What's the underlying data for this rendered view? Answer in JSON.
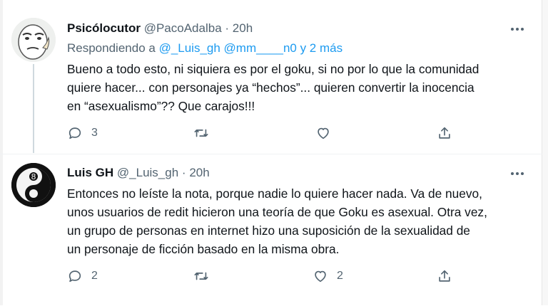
{
  "tweets": [
    {
      "name": "Psicólocutor",
      "handle": "@PacoAdalba",
      "dot": "·",
      "time": "20h",
      "reply_prefix": "Respondiendo a",
      "reply_mentions": "@_Luis_gh @mm____n0 y 2 más",
      "lines": [
        "Bueno a todo esto, ni siquiera es por el goku, si no por lo que la comunidad",
        "quiere hacer... con personajes ya “hechos”... quieren convertir la inocencia",
        "en “asexualismo”?? Que carajos!!!"
      ],
      "reply_count": "3",
      "retweet_count": "",
      "like_count": ""
    },
    {
      "name": "Luis GH",
      "handle": "@_Luis_gh",
      "dot": "·",
      "time": "20h",
      "lines": [
        "Entonces no leíste la nota, porque nadie lo quiere hacer nada. Va de nuevo,",
        "unos usuarios de redit hicieron una teoría de que Goku es asexual. Otra vez,",
        "un grupo de personas en internet hizo una suposición de la sexualidad de",
        "un personaje de ficción basado en la misma obra."
      ],
      "reply_count": "2",
      "retweet_count": "",
      "like_count": "2"
    }
  ],
  "icons": {
    "reply": "reply-icon",
    "retweet": "retweet-icon",
    "like": "heart-icon",
    "share": "share-icon",
    "more": "more-options-icon"
  },
  "colors": {
    "text": "#0f1419",
    "secondary": "#536471",
    "mention": "#1d9bf0",
    "thread_line": "#cfd9de"
  }
}
